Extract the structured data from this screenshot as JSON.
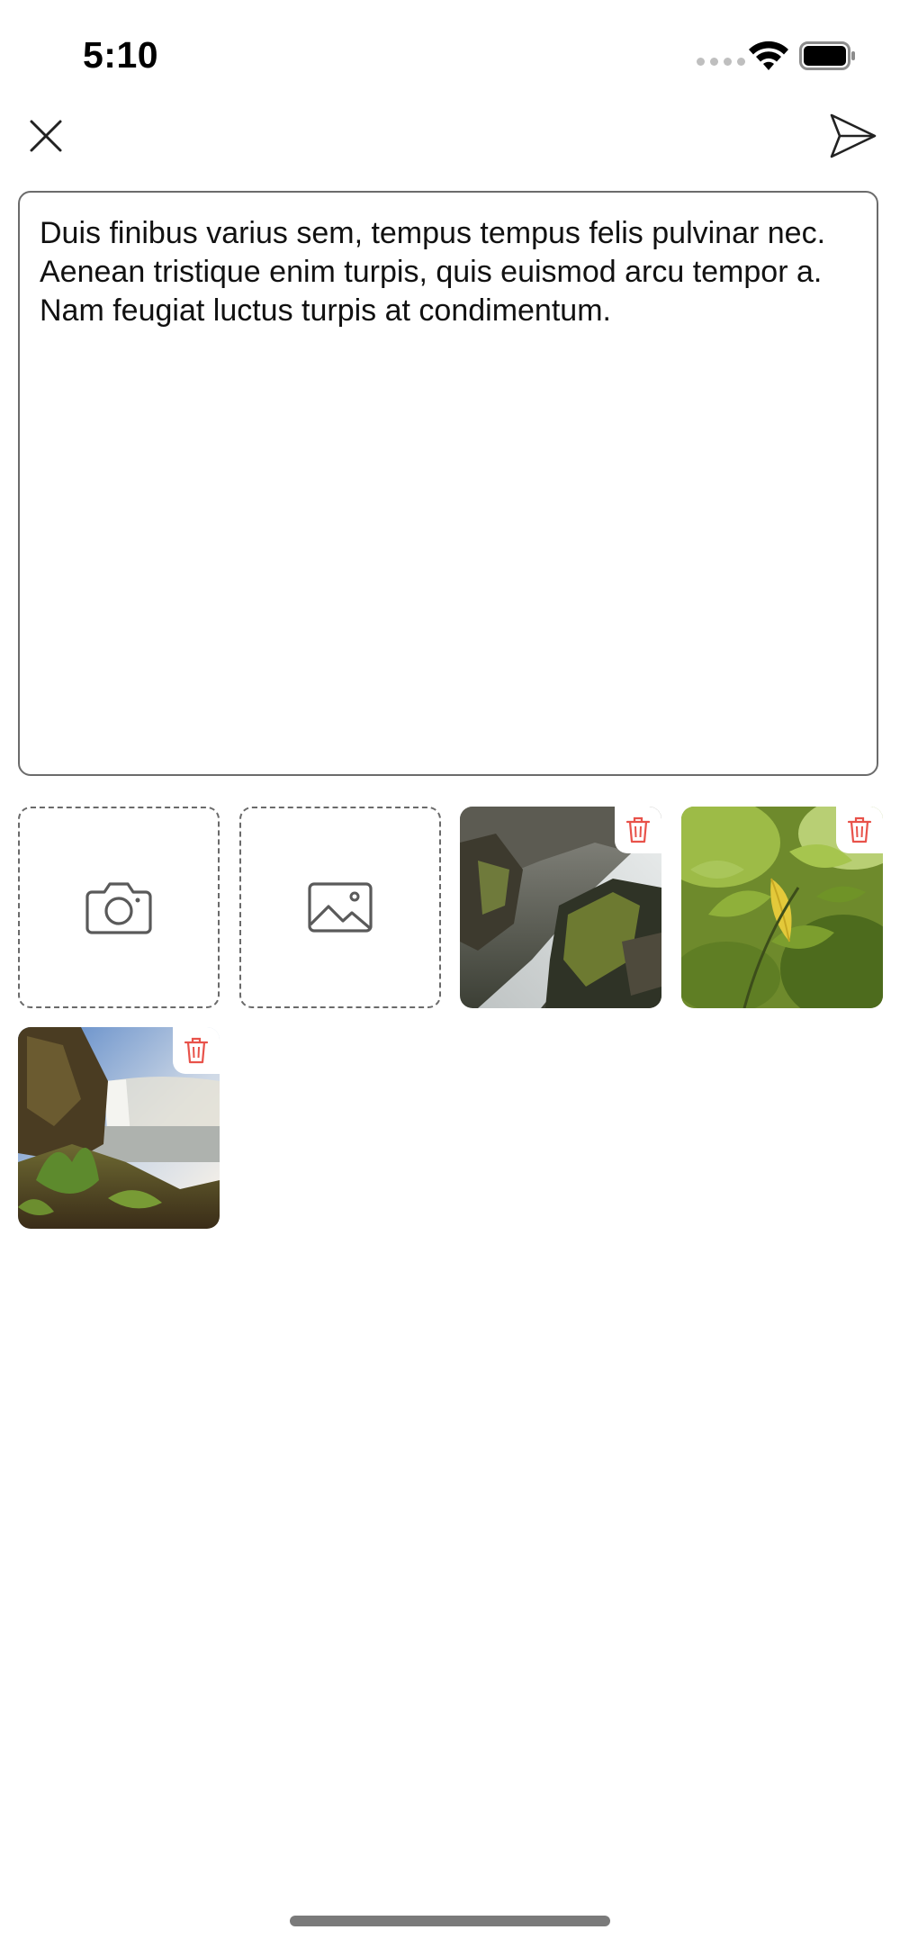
{
  "status_bar": {
    "time": "5:10"
  },
  "nav": {
    "close_icon": "close-icon",
    "send_icon": "send-icon"
  },
  "compose": {
    "message": "Duis finibus varius sem, tempus tempus felis pulvinar nec. Aenean tristique enim turpis, quis euismod arcu tempor a. Nam feugiat luctus turpis at condimentum."
  },
  "media": {
    "add_actions": [
      {
        "icon": "camera-icon"
      },
      {
        "icon": "image-icon"
      }
    ],
    "photos": [
      {
        "subject": "waterfall-rocks",
        "delete_icon": "trash-icon"
      },
      {
        "subject": "green-leaves",
        "delete_icon": "trash-icon"
      },
      {
        "subject": "waterfall-cliff",
        "delete_icon": "trash-icon"
      }
    ]
  },
  "colors": {
    "delete_accent": "#e8524a",
    "border": "#6b6b6b"
  }
}
